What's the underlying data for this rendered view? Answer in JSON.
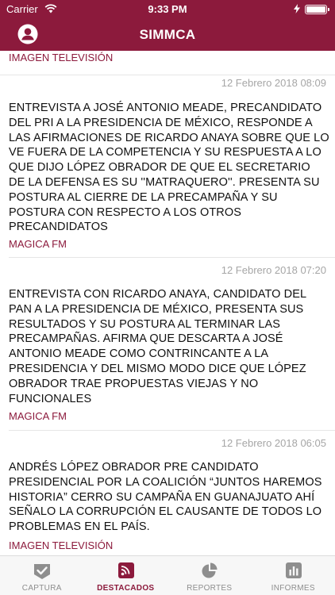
{
  "status_bar": {
    "carrier": "Carrier",
    "time": "9:33 PM",
    "battery_level": 1.0
  },
  "header": {
    "title": "SIMMCA"
  },
  "feed": {
    "top_source": "IMAGEN TELEVISIÓN",
    "entries": [
      {
        "date": "12 Febrero 2018 08:09",
        "text": "ENTREVISTA A JOSÉ ANTONIO MEADE, PRECANDIDATO DEL PRI A LA PRESIDENCIA DE MÉXICO, RESPONDE A LAS AFIRMACIONES DE RICARDO ANAYA SOBRE QUE LO VE FUERA DE LA COMPETENCIA Y SU RESPUESTA A LO QUE DIJO LÓPEZ OBRADOR DE QUE EL SECRETARIO DE LA DEFENSA ES SU ''MATRAQUERO''. PRESENTA SU POSTURA AL CIERRE DE LA PRECAMPAÑA Y SU POSTURA CON RESPECTO A LOS OTROS PRECANDIDATOS",
        "source": "MAGICA FM"
      },
      {
        "date": "12 Febrero 2018 07:20",
        "text": "ENTREVISTA CON RICARDO ANAYA, CANDIDATO DEL PAN A LA PRESIDENCIA DE MÉXICO, PRESENTA SUS RESULTADOS Y SU POSTURA AL TERMINAR LAS PRECAMPAÑAS. AFIRMA QUE DESCARTA A JOSÉ ANTONIO MEADE COMO CONTRINCANTE A LA PRESIDENCIA Y DEL MISMO MODO DICE QUE LÓPEZ OBRADOR TRAE PROPUESTAS VIEJAS Y NO FUNCIONALES",
        "source": "MAGICA FM"
      },
      {
        "date": "12 Febrero 2018 06:05",
        "text": "ANDRÉS LÓPEZ OBRADOR PRE CANDIDATO PRESIDENCIAL POR LA COALICIÓN “JUNTOS HAREMOS HISTORIA” CERRO SU CAMPAÑA EN GUANAJUATO AHÍ SEÑALO LA CORRUPCIÓN EL CAUSANTE DE TODOS LO PROBLEMAS EN EL PAÍS.",
        "source": "IMAGEN TELEVISIÓN"
      }
    ]
  },
  "tabbar": {
    "tabs": [
      {
        "label": "CAPTURA",
        "icon": "check-badge-icon",
        "active": false
      },
      {
        "label": "DESTACADOS",
        "icon": "rss-icon",
        "active": true
      },
      {
        "label": "REPORTES",
        "icon": "pie-chart-icon",
        "active": false
      },
      {
        "label": "INFORMES",
        "icon": "bar-chart-icon",
        "active": false
      }
    ]
  },
  "colors": {
    "brand": "#8c1a3c",
    "inactive": "#8e8e8e",
    "date": "#a6a6a6"
  }
}
